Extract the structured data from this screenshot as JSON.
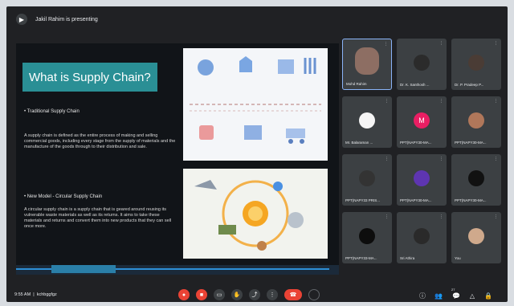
{
  "meeting": {
    "presenting_label": "Jakil Rahim is presenting",
    "time": "9:55 AM",
    "meeting_code": "kchbggfgz"
  },
  "slide": {
    "title": "What is Supply Chain?",
    "section1_heading": "• Traditional Supply Chain",
    "section1_body": "A supply chain is defined as the entire process of making and selling commercial goods, including every stage from the supply of materials and the manufacture of the goods through to their distribution and sale.",
    "section2_heading": "• New Model - Circular Supply Chain",
    "section2_body": "A circular supply chain is a supply chain that is geared around reusing its vulnerable waste materials as well as its returns. It aims to take these materials and returns and convert them into new products that they can sell once more."
  },
  "participants": [
    {
      "name": "Mohd Rahim",
      "avatar_color": "#8d6e63",
      "active": true
    },
    {
      "name": "Dr. K. Santhosh ...",
      "avatar_color": "#2b2b2b"
    },
    {
      "name": "Dr. P. Pradeep P...",
      "avatar_color": "#4a3c35"
    },
    {
      "name": "Mr. Balaraman ...",
      "avatar_color": "#f5f5f5"
    },
    {
      "name": "PPT(NAPY30-MA...",
      "avatar_color": "#e91e63",
      "initial": "M"
    },
    {
      "name": "PPT(NAPY30-MA...",
      "avatar_color": "#b0775a"
    },
    {
      "name": "PPT(NAPY33 PRIS...",
      "avatar_color": "#333333"
    },
    {
      "name": "PPT(NAPY30-MA...",
      "avatar_color": "#5e35b1"
    },
    {
      "name": "PPT(NAPY30-MA...",
      "avatar_color": "#111111"
    },
    {
      "name": "PPT(NAPY33-MA...",
      "avatar_color": "#0d0d0d"
    },
    {
      "name": "Sri Athira",
      "avatar_color": "#2a2a2a"
    },
    {
      "name": "You",
      "avatar_color": "#cfa98c"
    }
  ],
  "controls": {
    "participant_count": "27",
    "icons": [
      "mic-off-icon",
      "camera-off-icon",
      "captions-icon",
      "hand-icon",
      "present-icon",
      "more-icon",
      "end-call-icon"
    ]
  }
}
